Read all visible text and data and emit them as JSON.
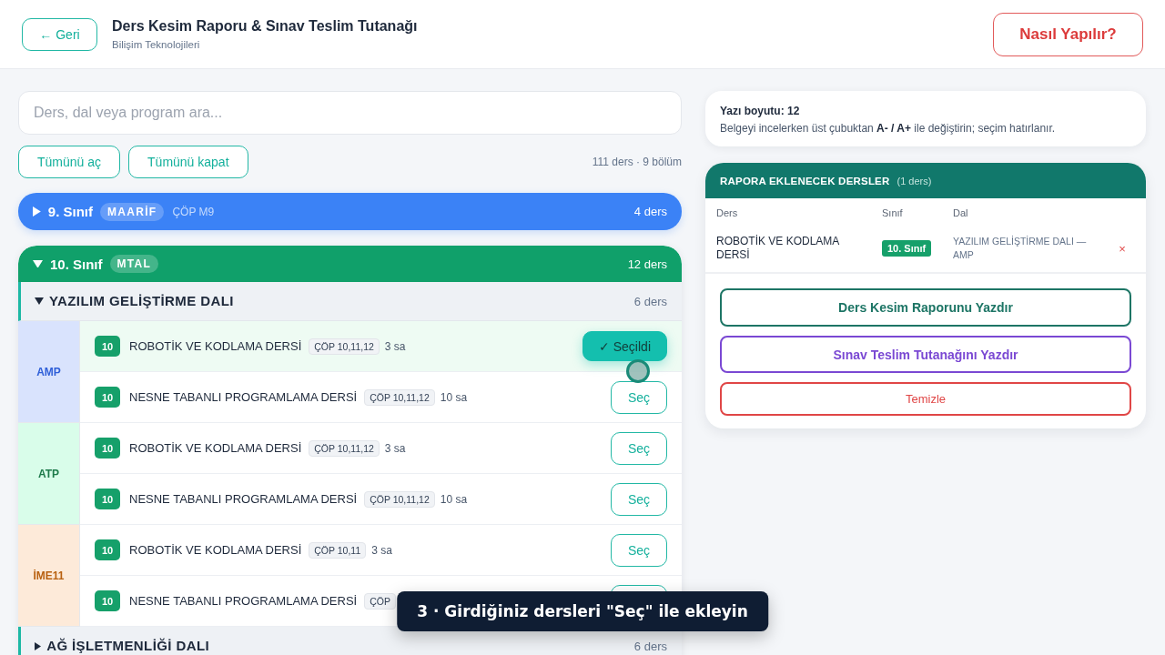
{
  "header": {
    "back_button": "← Geri",
    "title": "Ders Kesim Raporu & Sınav Teslim Tutanağı",
    "subtitle": "Bilişim Teknolojileri",
    "help_button": "Nasıl Yapılır?"
  },
  "search": {
    "placeholder": "Ders, dal veya program ara..."
  },
  "toolbar": {
    "buttons": [
      "Tümünü aç",
      "Tümünü kapat"
    ],
    "summary": "111 ders · 9 bölüm"
  },
  "grades": [
    {
      "label": "9. Sınıf",
      "expanded": false,
      "color": "#3b82f6",
      "badge": "MAARİF",
      "program": "ÇÖP M9",
      "count": "4 ders"
    },
    {
      "label": "10. Sınıf",
      "expanded": true,
      "color": "#10a06a",
      "badge": "MTAL",
      "count": "12 ders",
      "branches": [
        {
          "name": "YAZILIM GELİŞTİRME DALI",
          "expanded": true,
          "count": "6 ders",
          "programs": [
            {
              "name": "AMP",
              "color": "#2f5fd8",
              "courses": [
                {
                  "grade": "10",
                  "name": "ROBOTİK VE KODLAMA DERSİ",
                  "tag": "ÇÖP 10,11,12",
                  "hours": "3 sa",
                  "button": "✓ Seçildi",
                  "selected": true
                },
                {
                  "grade": "10",
                  "name": "NESNE TABANLI PROGRAMLAMA DERSİ",
                  "tag": "ÇÖP 10,11,12",
                  "hours": "10 sa",
                  "button": "Seç",
                  "selected": false
                }
              ]
            },
            {
              "name": "ATP",
              "color": "#1d7a4a",
              "courses": [
                {
                  "grade": "10",
                  "name": "ROBOTİK VE KODLAMA DERSİ",
                  "tag": "ÇÖP 10,11,12",
                  "hours": "3 sa",
                  "button": "Seç",
                  "selected": false
                },
                {
                  "grade": "10",
                  "name": "NESNE TABANLI PROGRAMLAMA DERSİ",
                  "tag": "ÇÖP 10,11,12",
                  "hours": "10 sa",
                  "button": "Seç",
                  "selected": false
                }
              ]
            },
            {
              "name": "İME11",
              "color": "#b8600f",
              "courses": [
                {
                  "grade": "10",
                  "name": "ROBOTİK VE KODLAMA DERSİ",
                  "tag": "ÇÖP 10,11",
                  "hours": "3 sa",
                  "button": "Seç",
                  "selected": false
                },
                {
                  "grade": "10",
                  "name": "NESNE TABANLI PROGRAMLAMA DERSİ",
                  "tag": "ÇÖP",
                  "selected": false
                }
              ]
            }
          ]
        },
        {
          "name": "AĞ İŞLETMENLİĞİ DALI",
          "expanded": false,
          "count": "6 ders"
        }
      ]
    }
  ],
  "font_size": {
    "title": "Yazı boyutu: 12",
    "hint": "Belgeyi incelerken üst çubuktan **A- / A+** ile değiştirin; seçim hatırlanır."
  },
  "report": {
    "title": "RAPORA EKLENECEK DERSLER",
    "count": "(1 ders)",
    "columns": [
      "Ders",
      "Sınıf",
      "Dal"
    ],
    "rows": [
      {
        "course": "ROBOTİK VE KODLAMA DERSİ",
        "grade": "10. Sınıf",
        "branch": "YAZILIM GELİŞTİRME DALI — AMP",
        "remove": "×"
      }
    ],
    "buttons": [
      {
        "label": "Ders Kesim Raporunu Yazdır",
        "kind": "primary"
      },
      {
        "label": "Sınav Teslim Tutanağını Yazdır",
        "kind": "secondary"
      },
      {
        "label": "Temizle",
        "kind": "danger"
      }
    ]
  },
  "toast": {
    "text": "3 · Girdiğiniz dersleri \"Seç\" ile ekleyin"
  }
}
